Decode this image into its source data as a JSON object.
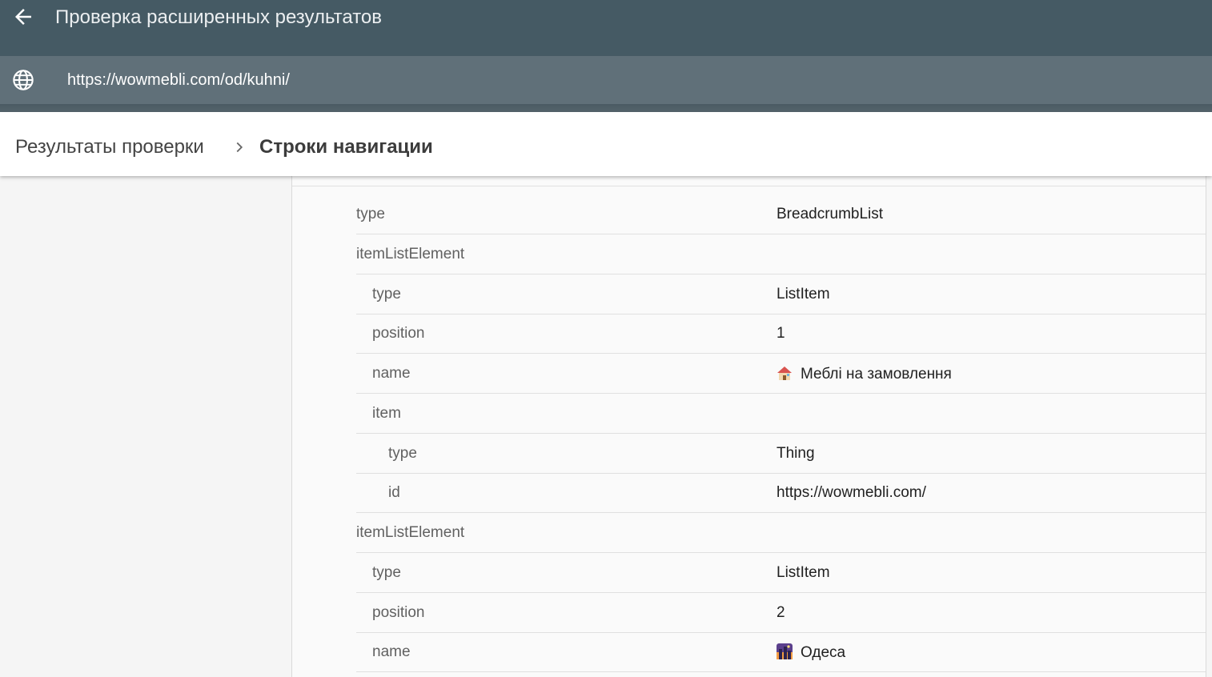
{
  "header": {
    "title": "Проверка расширенных результатов",
    "back_icon": "arrow-left-icon"
  },
  "urlbar": {
    "url": "https://wowmebli.com/od/kuhni/",
    "icon": "globe-icon"
  },
  "breadcrumb": {
    "parent": "Результаты проверки",
    "separator_icon": "chevron-right-icon",
    "current": "Строки навигации"
  },
  "colors": {
    "topbar": "#455a64",
    "urlbar": "#607079",
    "panel": "#fafafa",
    "divider": "#e0e0e0"
  },
  "rows": [
    {
      "key": "type",
      "value": "BreadcrumbList",
      "level": 0
    },
    {
      "key": "itemListElement",
      "value": "",
      "level": 0
    },
    {
      "key": "type",
      "value": "ListItem",
      "level": 1
    },
    {
      "key": "position",
      "value": "1",
      "level": 1
    },
    {
      "key": "name",
      "value": "Меблі на замовлення",
      "value_icon": "house-emoji-icon",
      "level": 1
    },
    {
      "key": "item",
      "value": "",
      "level": 1
    },
    {
      "key": "type",
      "value": "Thing",
      "level": 2
    },
    {
      "key": "id",
      "value": "https://wowmebli.com/",
      "level": 2
    },
    {
      "key": "itemListElement",
      "value": "",
      "level": 0
    },
    {
      "key": "type",
      "value": "ListItem",
      "level": 1
    },
    {
      "key": "position",
      "value": "2",
      "level": 1
    },
    {
      "key": "name",
      "value": "Одеса",
      "value_icon": "city-night-emoji-icon",
      "level": 1
    }
  ]
}
